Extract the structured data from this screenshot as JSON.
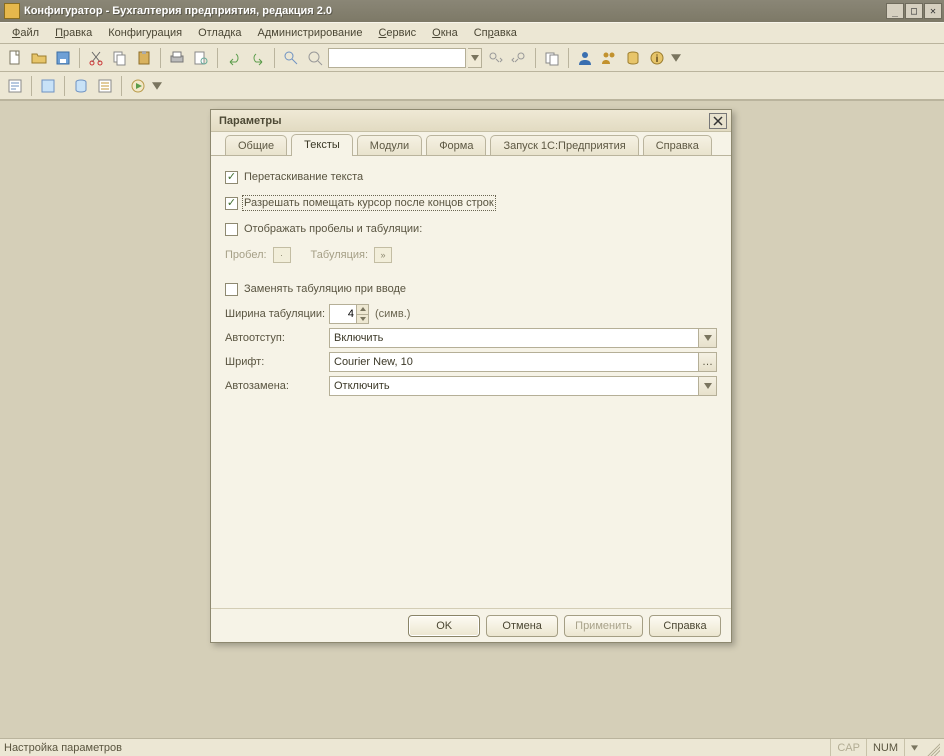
{
  "window": {
    "title": "Конфигуратор - Бухгалтерия предприятия, редакция 2.0"
  },
  "menu": {
    "file": "Файл",
    "edit": "Правка",
    "config": "Конфигурация",
    "debug": "Отладка",
    "admin": "Администрирование",
    "service": "Сервис",
    "windows": "Окна",
    "help": "Справка"
  },
  "dialog": {
    "title": "Параметры",
    "tabs": {
      "general": "Общие",
      "texts": "Тексты",
      "modules": "Модули",
      "form": "Форма",
      "launch": "Запуск 1С:Предприятия",
      "help": "Справка"
    },
    "texts": {
      "drag_text": {
        "label": "Перетаскивание текста",
        "checked": true
      },
      "cursor_eol": {
        "label": "Разрешать помещать курсор после концов строк",
        "checked": true
      },
      "show_ws": {
        "label": "Отображать пробелы и табуляции:",
        "checked": false
      },
      "space_label": "Пробел:",
      "space_char": "·",
      "tab_label": "Табуляция:",
      "tab_char": "»",
      "replace_tabs": {
        "label": "Заменять табуляцию при вводе",
        "checked": false
      },
      "tab_width_label": "Ширина табуляции:",
      "tab_width_value": "4",
      "tab_width_unit": "(симв.)",
      "autoindent_label": "Автоотступ:",
      "autoindent_value": "Включить",
      "font_label": "Шрифт:",
      "font_value": "Courier New, 10",
      "autoreplace_label": "Автозамена:",
      "autoreplace_value": "Отключить"
    },
    "buttons": {
      "ok": "OK",
      "cancel": "Отмена",
      "apply": "Применить",
      "help": "Справка"
    }
  },
  "status": {
    "text": "Настройка параметров",
    "cap": "CAP",
    "num": "NUM"
  }
}
